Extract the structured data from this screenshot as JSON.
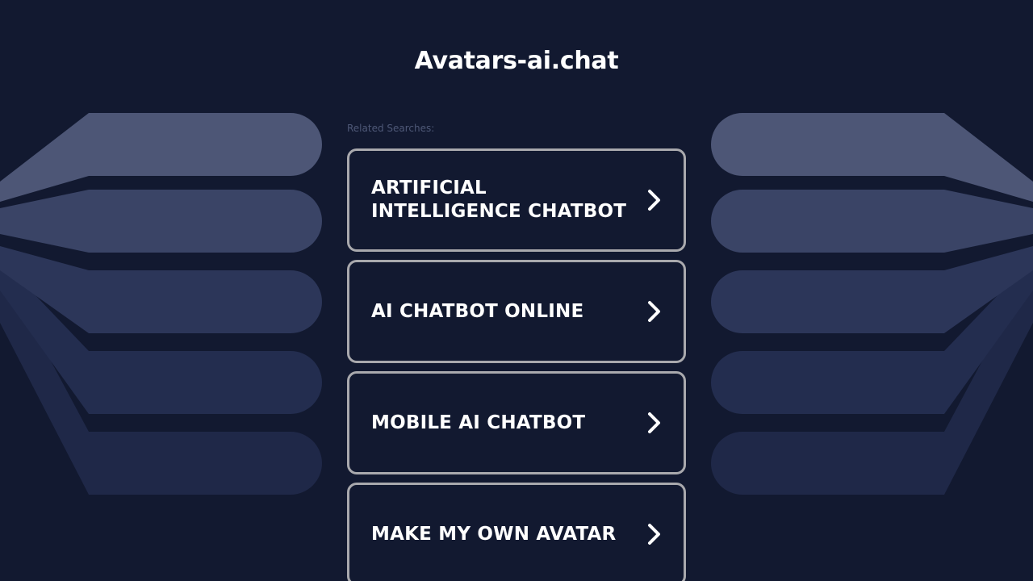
{
  "site": {
    "title": "Avatars-ai.chat"
  },
  "related": {
    "label": "Related Searches:",
    "links": [
      {
        "label": "ARTIFICIAL INTELLIGENCE CHATBOT",
        "icon": "chevron-right-icon"
      },
      {
        "label": "AI CHATBOT ONLINE",
        "icon": "chevron-right-icon"
      },
      {
        "label": "MOBILE AI CHATBOT",
        "icon": "chevron-right-icon"
      },
      {
        "label": "MAKE MY OWN AVATAR",
        "icon": "chevron-right-icon"
      }
    ]
  },
  "colors": {
    "background": "#121930",
    "card_border": "#a9a9ad",
    "text": "#ffffff",
    "muted_text": "#4e5877",
    "decor_band_1": "#4d5676",
    "decor_band_2": "#3a4466",
    "decor_band_3": "#2c3659",
    "decor_band_4": "#232d4f",
    "decor_band_5": "#1f2848"
  }
}
